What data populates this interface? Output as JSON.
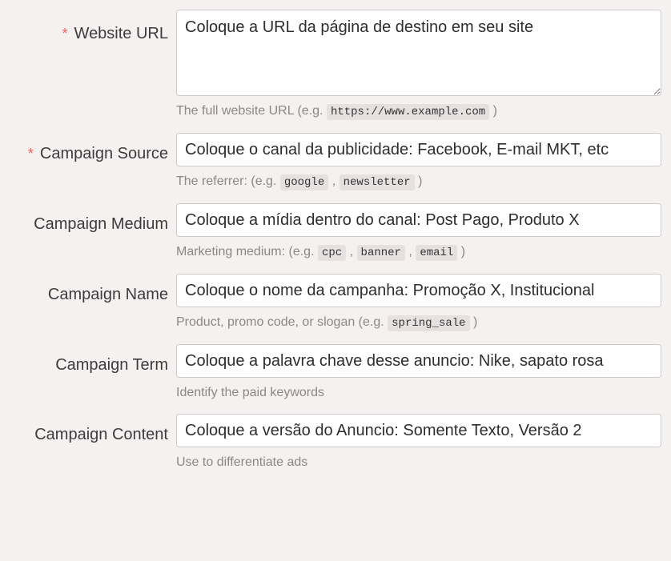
{
  "form": {
    "fields": [
      {
        "label": "Website URL",
        "required": true,
        "required_marker": "*",
        "control": "textarea",
        "value": "Coloque a URL da página de destino em seu site",
        "help_prefix": "The full website URL (e.g.",
        "help_codes": [
          "https://www.example.com"
        ],
        "help_suffix": ")"
      },
      {
        "label": "Campaign Source",
        "required": true,
        "required_marker": "*",
        "control": "input",
        "value": "Coloque o canal da publicidade: Facebook, E-mail MKT, etc",
        "help_prefix": "The referrer: (e.g.",
        "help_codes": [
          "google",
          "newsletter"
        ],
        "help_suffix": ")"
      },
      {
        "label": "Campaign Medium",
        "required": false,
        "required_marker": "",
        "control": "input",
        "value": "Coloque a mídia dentro do canal: Post Pago, Produto X",
        "help_prefix": "Marketing medium: (e.g.",
        "help_codes": [
          "cpc",
          "banner",
          "email"
        ],
        "help_suffix": ")"
      },
      {
        "label": "Campaign Name",
        "required": false,
        "required_marker": "",
        "control": "input",
        "value": "Coloque o nome da campanha: Promoção X, Institucional",
        "help_prefix": "Product, promo code, or slogan (e.g.",
        "help_codes": [
          "spring_sale"
        ],
        "help_suffix": ")"
      },
      {
        "label": "Campaign Term",
        "required": false,
        "required_marker": "",
        "control": "input",
        "value": "Coloque a palavra chave desse anuncio: Nike, sapato rosa",
        "help_prefix": "Identify the paid keywords",
        "help_codes": [],
        "help_suffix": ""
      },
      {
        "label": "Campaign Content",
        "required": false,
        "required_marker": "",
        "control": "input",
        "value": "Coloque a versão do Anuncio: Somente Texto, Versão 2",
        "help_prefix": "Use to differentiate ads",
        "help_codes": [],
        "help_suffix": ""
      }
    ],
    "separator": ","
  },
  "colors": {
    "page_background": "#f5f1f0",
    "input_background": "#ffffff",
    "input_border": "#cdc9c8",
    "label_text": "#3c3c3c",
    "help_text": "#8d8785",
    "required_asterisk": "#f0605c",
    "code_chip_background": "#e6e1e0"
  }
}
